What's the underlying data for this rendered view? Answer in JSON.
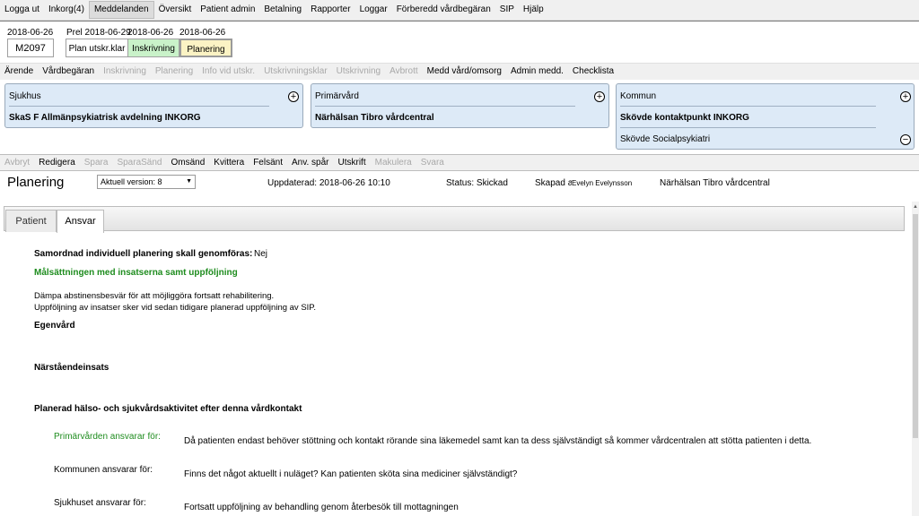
{
  "menu": [
    "Logga ut",
    "Inkorg(4)",
    "Meddelanden",
    "Översikt",
    "Patient admin",
    "Betalning",
    "Rapporter",
    "Loggar",
    "Förberedd vårdbegäran",
    "SIP",
    "Hjälp"
  ],
  "cases": {
    "case_id_date": "2018-06-26",
    "case_id": "M2097",
    "prel_date": "Prel 2018-06-29",
    "plan_label": "Plan utskr.klar",
    "inskr_date": "2018-06-26",
    "inskr_label": "Inskrivning",
    "plan_date": "2018-06-26",
    "planering_label": "Planering"
  },
  "toolbar1": [
    {
      "label": "Ärende",
      "enabled": true
    },
    {
      "label": "Vårdbegäran",
      "enabled": true
    },
    {
      "label": "Inskrivning",
      "enabled": false
    },
    {
      "label": "Planering",
      "enabled": false
    },
    {
      "label": "Info vid utskr.",
      "enabled": false
    },
    {
      "label": "Utskrivningsklar",
      "enabled": false
    },
    {
      "label": "Utskrivning",
      "enabled": false
    },
    {
      "label": "Avbrott",
      "enabled": false
    },
    {
      "label": "Medd vård/omsorg",
      "enabled": true
    },
    {
      "label": "Admin medd.",
      "enabled": true
    },
    {
      "label": "Checklista",
      "enabled": true
    }
  ],
  "panels": {
    "sjukhus": {
      "title": "Sjukhus",
      "value": "SkaS F Allmänpsykiatrisk avdelning INKORG"
    },
    "primarvard": {
      "title": "Primärvård",
      "value": "Närhälsan Tibro vårdcentral"
    },
    "kommun": {
      "title": "Kommun",
      "value": "Skövde kontaktpunkt INKORG",
      "value2": "Skövde Socialpsykiatri"
    },
    "plus_symbol": "+",
    "minus_symbol": "−"
  },
  "toolbar2": [
    {
      "label": "Avbryt",
      "enabled": false
    },
    {
      "label": "Redigera",
      "enabled": true
    },
    {
      "label": "Spara",
      "enabled": false
    },
    {
      "label": "SparaSänd",
      "enabled": false
    },
    {
      "label": "Omsänd",
      "enabled": true
    },
    {
      "label": "Kvittera",
      "enabled": true
    },
    {
      "label": "Felsänt",
      "enabled": true
    },
    {
      "label": "Anv. spår",
      "enabled": true
    },
    {
      "label": "Utskrift",
      "enabled": true
    },
    {
      "label": "Makulera",
      "enabled": false
    },
    {
      "label": "Svara",
      "enabled": false
    }
  ],
  "info": {
    "title": "Planering",
    "version_select": "Aktuell version: 8",
    "updated": "Uppdaterad: 2018-06-26 10:10",
    "status": "Status: Skickad",
    "created_label": "Skapad av:",
    "created_by": "Evelyn Evelynsson",
    "created_unit": "Närhälsan Tibro vårdcentral"
  },
  "tabs": [
    "Patient",
    "Ansvar"
  ],
  "content": {
    "samordnad_label": "Samordnad individuell planering skall genomföras:",
    "samordnad_value": "Nej",
    "malsattning_heading": "Målsättningen med insatserna samt uppföljning",
    "malsattning_line1": "Dämpa abstinensbesvär för att möjliggöra fortsatt rehabilitering.",
    "malsattning_line2": "Uppföljning av insatser sker vid sedan tidigare planerad uppföljning av SIP.",
    "egenvard": "Egenvård",
    "narstaende": "Närståendeinsats",
    "planerad": "Planerad hälso- och sjukvårdsaktivitet efter denna vårdkontakt",
    "prim_label": "Primärvården ansvarar för:",
    "prim_text": "Då patienten endast behöver stöttning och kontakt rörande sina läkemedel samt kan ta dess självständigt så kommer vårdcentralen att stötta patienten i detta.",
    "kommun_label": "Kommunen ansvarar för:",
    "kommun_text": "Finns det något aktuellt i nuläget? Kan patienten sköta sina mediciner självständigt?",
    "sjukhus_label": "Sjukhuset ansvarar för:",
    "sjukhus_text": "Fortsatt uppföljning av behandling genom återbesök till mottagningen"
  },
  "colors": {
    "panel_bg": "#ddeaf7",
    "inskrivning_bg": "#c9f2c9",
    "planering_bg": "#fbf3c4",
    "green_text": "#1e8c1e",
    "disabled_text": "#a8a8a8"
  }
}
